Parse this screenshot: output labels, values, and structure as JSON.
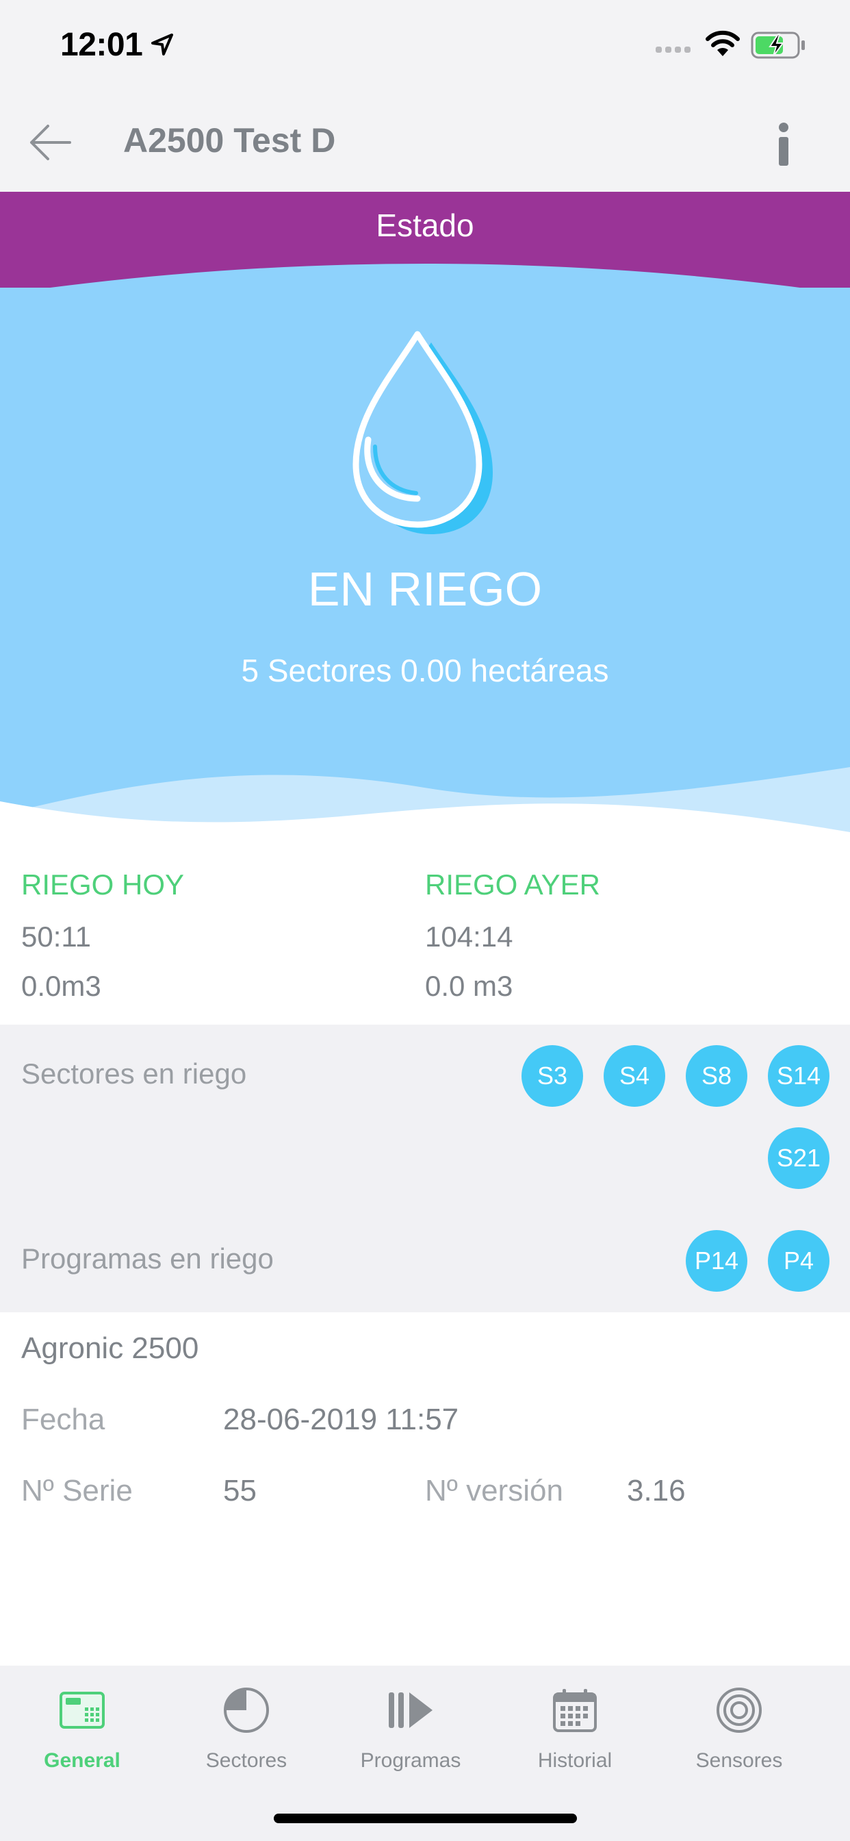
{
  "status_bar": {
    "time": "12:01"
  },
  "nav": {
    "title": "A2500 Test D"
  },
  "header": {
    "section_title": "Estado"
  },
  "status": {
    "state": "EN RIEGO",
    "summary": "5 Sectores 0.00 hectáreas",
    "icon": "water-drop-icon"
  },
  "stats": {
    "today": {
      "label": "RIEGO HOY",
      "time": "50:11",
      "volume": "0.0m3"
    },
    "yesterday": {
      "label": "RIEGO AYER",
      "time": "104:14",
      "volume": "0.0 m3"
    }
  },
  "active": {
    "sectors_label": "Sectores en riego",
    "sectors": [
      "S3",
      "S4",
      "S8",
      "S14",
      "S21"
    ],
    "programs_label": "Programas en riego",
    "programs": [
      "P14",
      "P4"
    ]
  },
  "device": {
    "name": "Agronic 2500",
    "date_label": "Fecha",
    "date_value": "28-06-2019 11:57",
    "serial_label": "Nº Serie",
    "serial_value": "55",
    "version_label": "Nº versión",
    "version_value": "3.16"
  },
  "tabs": [
    {
      "label": "General",
      "icon": "general-icon",
      "active": true
    },
    {
      "label": "Sectores",
      "icon": "sectors-icon",
      "active": false
    },
    {
      "label": "Programas",
      "icon": "programs-icon",
      "active": false
    },
    {
      "label": "Historial",
      "icon": "calendar-icon",
      "active": false
    },
    {
      "label": "Sensores",
      "icon": "sensors-icon",
      "active": false
    }
  ],
  "colors": {
    "header": "#9a3497",
    "sky": "#8ed2fc",
    "accent_green": "#4ed07a",
    "chip": "#44c9f6"
  }
}
